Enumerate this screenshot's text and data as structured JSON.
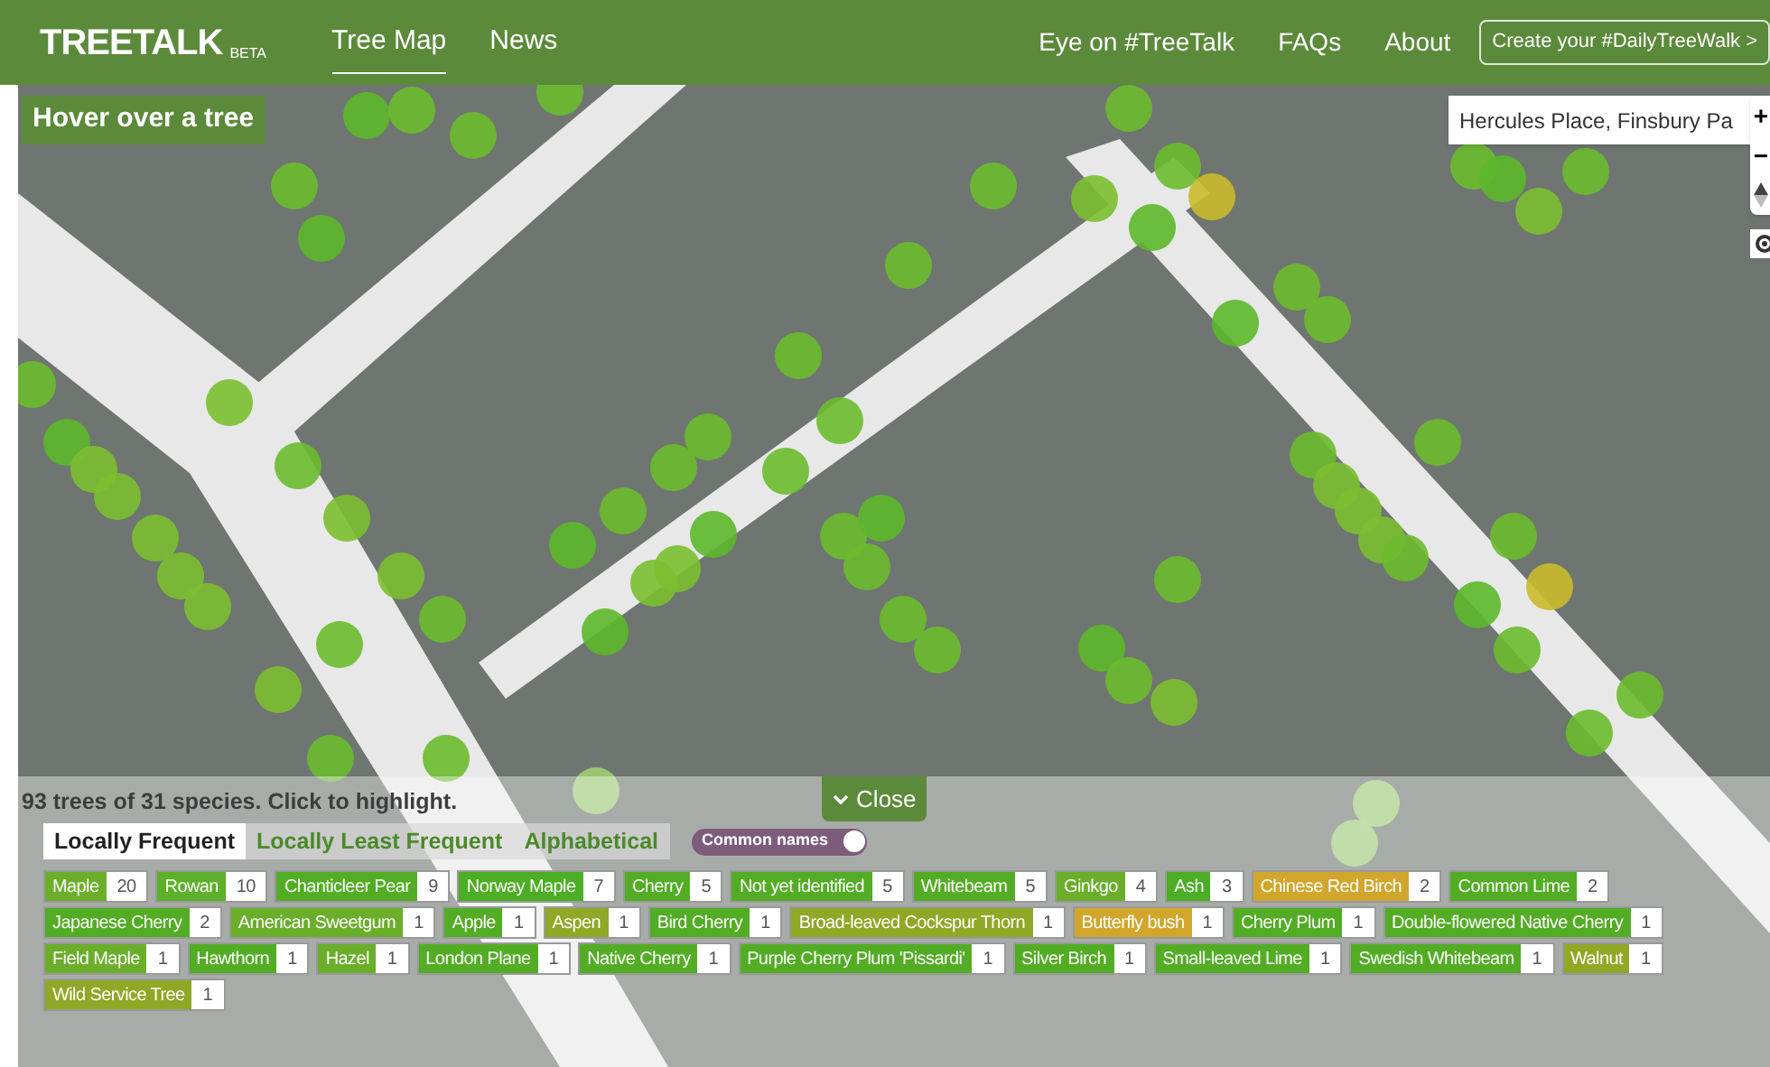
{
  "header": {
    "logo": "TREETALK",
    "logo_badge": "BETA",
    "nav_left": [
      {
        "label": "Tree Map",
        "selected": true
      },
      {
        "label": "News",
        "selected": false
      }
    ],
    "nav_right": [
      "Eye on #TreeTalk",
      "FAQs",
      "About"
    ],
    "cta": "Create your #DailyTreeWalk >"
  },
  "map": {
    "hover_hint": "Hover over a tree",
    "search": {
      "value": "Hercules Place, Finsbury Pa"
    },
    "zoom_in": "+",
    "zoom_out": "−"
  },
  "panel": {
    "summary": "93 trees of 31 species. Click to highlight.",
    "close": "Close",
    "tabs": [
      {
        "label": "Locally Frequent",
        "selected": true
      },
      {
        "label": "Locally Least Frequent",
        "selected": false
      },
      {
        "label": "Alphabetical",
        "selected": false
      }
    ],
    "toggle": {
      "label": "Common names",
      "on": true
    },
    "species": [
      {
        "name": "Maple",
        "count": "20",
        "color": "#6aae2a"
      },
      {
        "name": "Rowan",
        "count": "10",
        "color": "#5cb02a"
      },
      {
        "name": "Chanticleer Pear",
        "count": "9",
        "color": "#52ad24"
      },
      {
        "name": "Norway Maple",
        "count": "7",
        "color": "#4cae24"
      },
      {
        "name": "Cherry",
        "count": "5",
        "color": "#52ad24"
      },
      {
        "name": "Not yet identified",
        "count": "5",
        "color": "#52ad24"
      },
      {
        "name": "Whitebeam",
        "count": "5",
        "color": "#52ad24"
      },
      {
        "name": "Ginkgo",
        "count": "4",
        "color": "#6aae2a"
      },
      {
        "name": "Ash",
        "count": "3",
        "color": "#4cae24"
      },
      {
        "name": "Chinese Red Birch",
        "count": "2",
        "color": "#d2a62b"
      },
      {
        "name": "Common Lime",
        "count": "2",
        "color": "#52ad24"
      },
      {
        "name": "Japanese Cherry",
        "count": "2",
        "color": "#52ad24"
      },
      {
        "name": "American Sweetgum",
        "count": "1",
        "color": "#6aae2a"
      },
      {
        "name": "Apple",
        "count": "1",
        "color": "#52ad24"
      },
      {
        "name": "Aspen",
        "count": "1",
        "color": "#8fa826"
      },
      {
        "name": "Bird Cherry",
        "count": "1",
        "color": "#52ad24"
      },
      {
        "name": "Broad-leaved Cockspur Thorn",
        "count": "1",
        "color": "#8fa826"
      },
      {
        "name": "Butterfly bush",
        "count": "1",
        "color": "#d2a62b"
      },
      {
        "name": "Cherry Plum",
        "count": "1",
        "color": "#52ad24"
      },
      {
        "name": "Double-flowered Native Cherry",
        "count": "1",
        "color": "#52ad24"
      },
      {
        "name": "Field Maple",
        "count": "1",
        "color": "#6aae2a"
      },
      {
        "name": "Hawthorn",
        "count": "1",
        "color": "#52ad24"
      },
      {
        "name": "Hazel",
        "count": "1",
        "color": "#6aae2a"
      },
      {
        "name": "London Plane",
        "count": "1",
        "color": "#52ad24"
      },
      {
        "name": "Native Cherry",
        "count": "1",
        "color": "#52ad24"
      },
      {
        "name": "Purple Cherry Plum 'Pissardi'",
        "count": "1",
        "color": "#52ad24"
      },
      {
        "name": "Silver Birch",
        "count": "1",
        "color": "#52ad24"
      },
      {
        "name": "Small-leaved Lime",
        "count": "1",
        "color": "#52ad24"
      },
      {
        "name": "Swedish Whitebeam",
        "count": "1",
        "color": "#52ad24"
      },
      {
        "name": "Walnut",
        "count": "1",
        "color": "#8fa826"
      },
      {
        "name": "Wild Service Tree",
        "count": "1",
        "color": "#8fa826"
      }
    ]
  }
}
